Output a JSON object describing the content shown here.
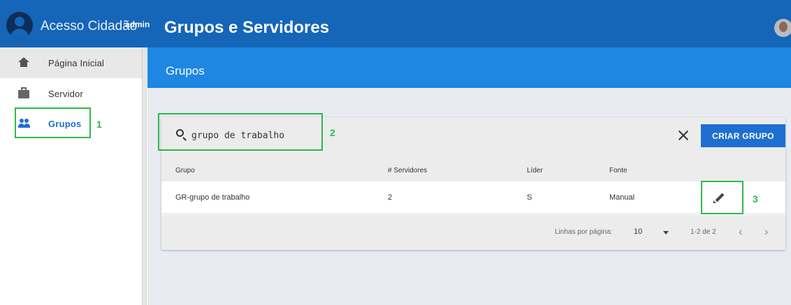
{
  "app": {
    "brand": "Acesso Cidadão",
    "brand_sup": "admin",
    "page_title": "Grupos e Servidores"
  },
  "sidebar": {
    "items": [
      {
        "label": "Página Inicial",
        "icon": "home-icon"
      },
      {
        "label": "Servidor",
        "icon": "briefcase-icon"
      },
      {
        "label": "Grupos",
        "icon": "people-icon"
      }
    ]
  },
  "main": {
    "section_title": "Grupos",
    "search": {
      "value": "grupo de trabalho"
    },
    "create_button": "CRIAR GRUPO",
    "table": {
      "headers": [
        "Grupo",
        "# Servidores",
        "Líder",
        "Fonte"
      ],
      "rows": [
        {
          "grupo": "GR-grupo de trabalho",
          "servidores": "2",
          "lider": "S",
          "fonte": "Manual"
        }
      ]
    },
    "pagination": {
      "rows_per_page_label": "Linhas por página:",
      "rows_per_page": "10",
      "range": "1-2 de 2",
      "prev": "‹",
      "next": "›"
    }
  },
  "annotations": [
    "1",
    "2",
    "3"
  ],
  "colors": {
    "topbar": "#1565b8",
    "section_bar": "#1e86e3",
    "accent": "#1e6fd0",
    "annotation": "#2fb84a"
  }
}
